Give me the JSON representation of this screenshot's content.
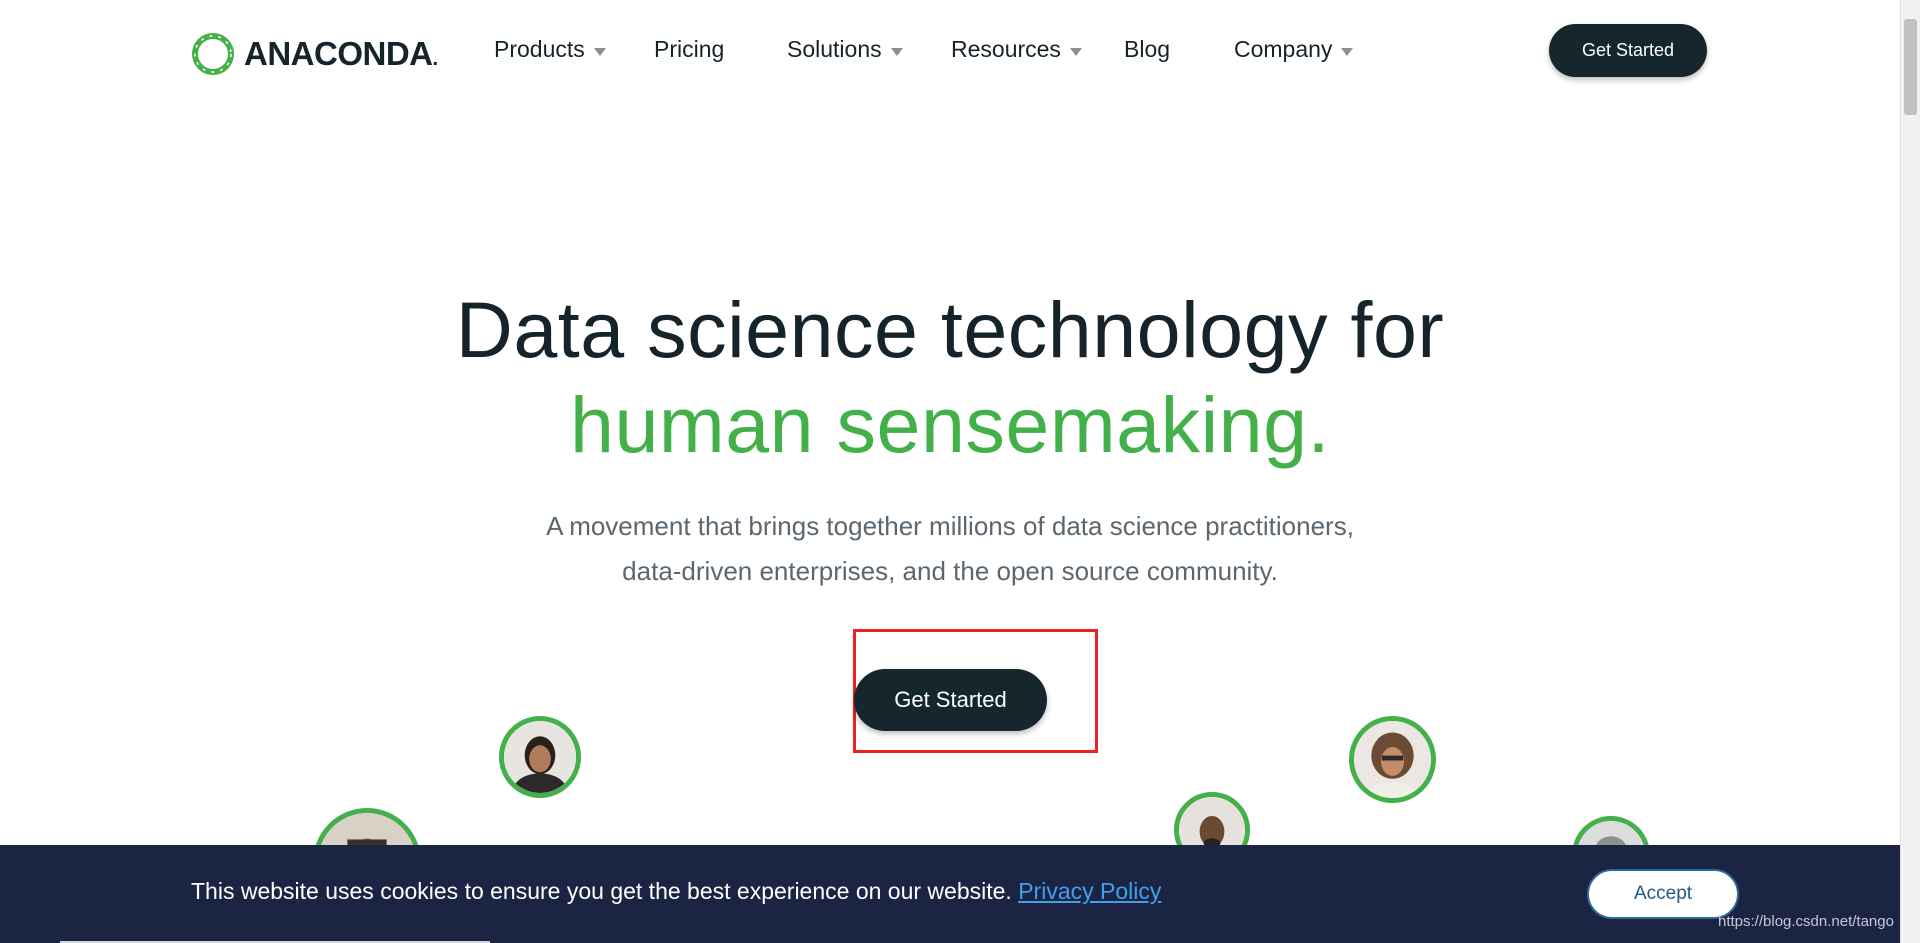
{
  "header": {
    "logo_text": "ANACONDA",
    "logo_suffix": ".",
    "nav": [
      {
        "label": "Products",
        "has_dropdown": true
      },
      {
        "label": "Pricing",
        "has_dropdown": false
      },
      {
        "label": "Solutions",
        "has_dropdown": true
      },
      {
        "label": "Resources",
        "has_dropdown": true
      },
      {
        "label": "Blog",
        "has_dropdown": false
      },
      {
        "label": "Company",
        "has_dropdown": true
      }
    ],
    "cta_label": "Get Started"
  },
  "hero": {
    "title_line1": "Data science technology for",
    "title_line2": "human sensemaking.",
    "subtitle_line1": "A movement that brings together millions of data science practitioners,",
    "subtitle_line2": "data-driven enterprises, and the open source community.",
    "cta_label": "Get Started"
  },
  "cookie_banner": {
    "message": "This website uses cookies to ensure you get the best experience on our website.",
    "link_label": "Privacy Policy",
    "accept_label": "Accept"
  },
  "watermark": "https://blog.csdn.net/tango",
  "colors": {
    "accent_green": "#43b049",
    "dark": "#15262c",
    "cookie_bg": "#1b2442",
    "highlight": "#ef2020"
  }
}
